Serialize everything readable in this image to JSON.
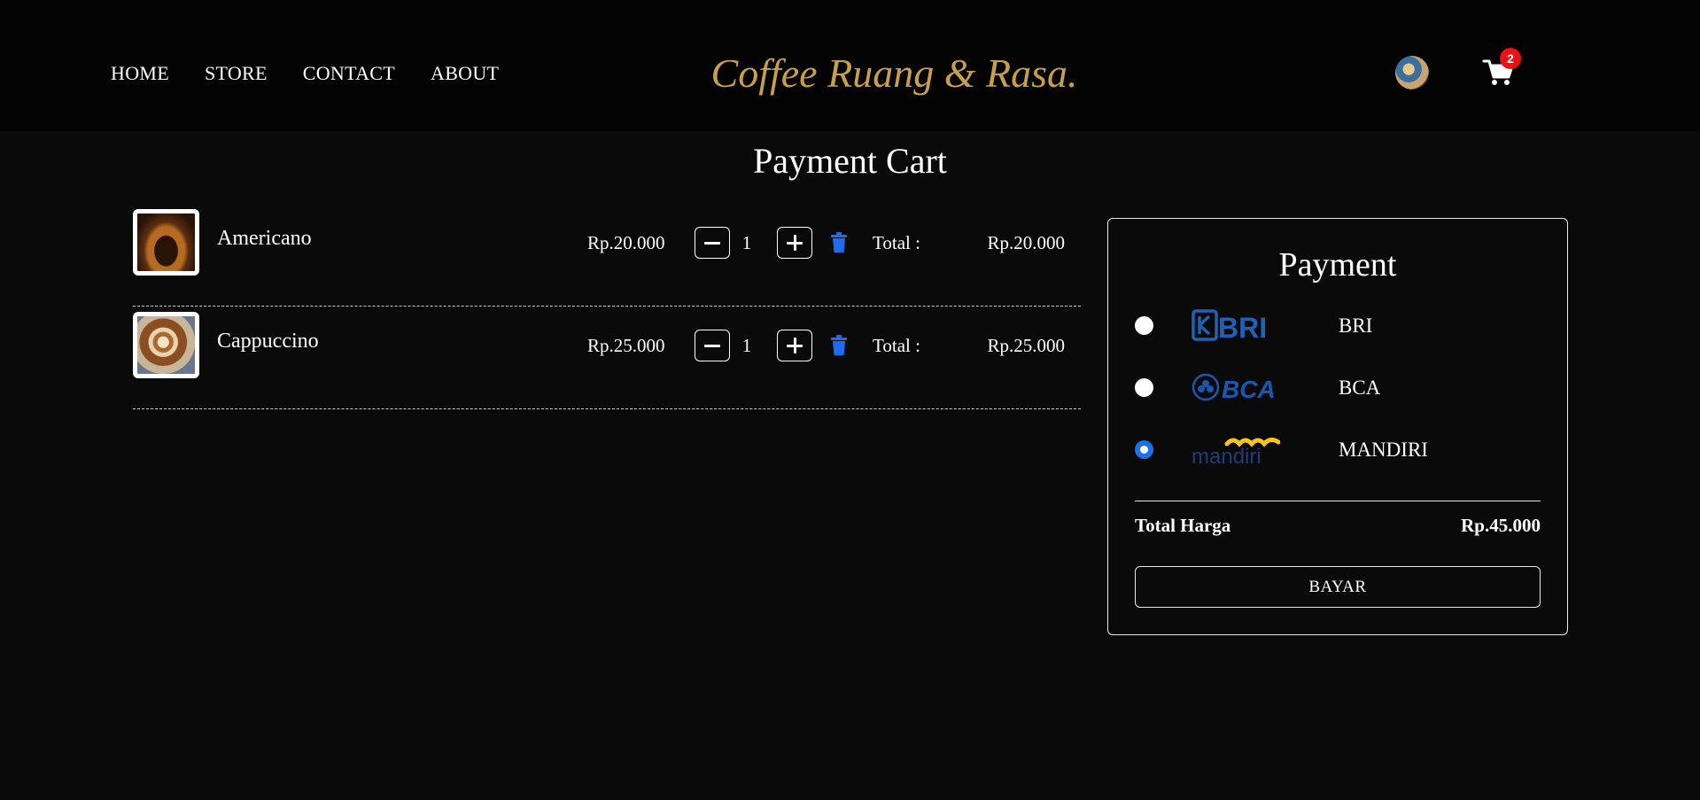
{
  "header": {
    "nav": [
      "HOME",
      "STORE",
      "CONTACT",
      "ABOUT"
    ],
    "brand": "Coffee Ruang & Rasa.",
    "cart_count": "2",
    "avatar_icon": "user-avatar",
    "cart_icon": "shopping-cart-icon"
  },
  "page_title": "Payment Cart",
  "cart": {
    "items": [
      {
        "name": "Americano",
        "price": "Rp.20.000",
        "qty": "1",
        "total_label": "Total :",
        "total": "Rp.20.000"
      },
      {
        "name": "Cappuccino",
        "price": "Rp.25.000",
        "qty": "1",
        "total_label": "Total :",
        "total": "Rp.25.000"
      }
    ]
  },
  "payment": {
    "title": "Payment",
    "methods": [
      {
        "logo_text": "BRI",
        "name": "BRI",
        "selected": false
      },
      {
        "logo_text": "BCA",
        "name": "BCA",
        "selected": false
      },
      {
        "logo_text": "mandiri",
        "name": "MANDIRI",
        "selected": true
      }
    ],
    "total_label": "Total Harga",
    "total_value": "Rp.45.000",
    "pay_button": "BAYAR"
  },
  "colors": {
    "brand": "#c8a04a",
    "accent_blue": "#1a73e8",
    "trash_blue": "#1e6cf0",
    "badge_red": "#ee1111",
    "bri_blue": "#1d62b6",
    "bca_blue": "#1a57b0",
    "mandiri_navy": "#1f3c78",
    "mandiri_gold": "#f5c518"
  }
}
